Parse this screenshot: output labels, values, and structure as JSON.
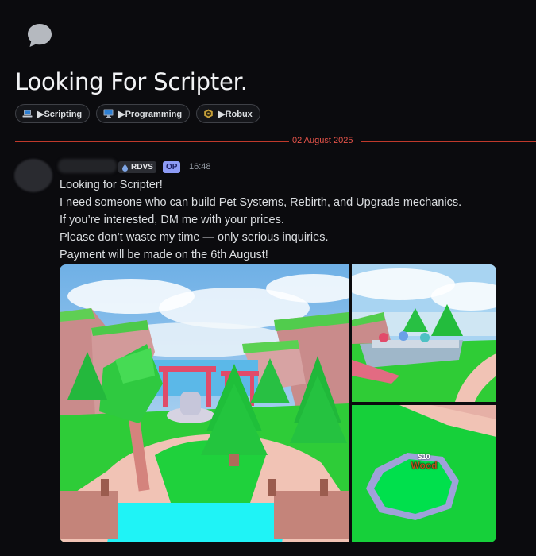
{
  "thread": {
    "title": "Looking For Scripter.",
    "tags": [
      {
        "label": "▶Scripting",
        "icon": "laptop-icon"
      },
      {
        "label": "▶Programming",
        "icon": "monitor-icon"
      },
      {
        "label": "▶Robux",
        "icon": "robux-icon"
      }
    ]
  },
  "divider": {
    "date": "02 August 2025"
  },
  "post": {
    "author_tag": "RDVS",
    "op_badge": "OP",
    "timestamp": "16:48",
    "lines": [
      "Looking for Scripter!",
      "I need someone who can build Pet Systems, Rebirth, and Upgrade mechanics.",
      "If you’re interested, DM me with your prices.",
      "Please don’t waste my time — only serious inquiries.",
      "Payment will be made on the 6th August!"
    ],
    "attachments": {
      "third": {
        "price": "$10",
        "item": "Wood"
      }
    }
  },
  "colors": {
    "background": "#0b0b0e",
    "divider": "#c0392b",
    "op_badge": "#8d9bf5"
  }
}
